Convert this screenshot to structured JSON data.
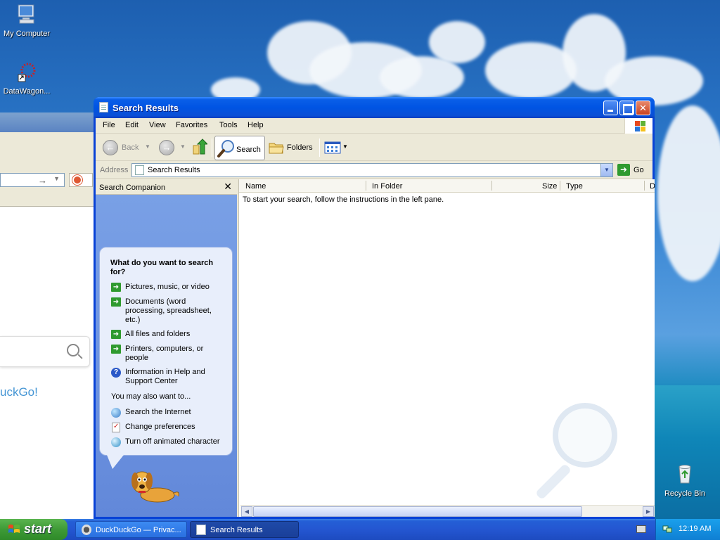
{
  "desktop": {
    "icons": [
      {
        "label": "My Computer"
      },
      {
        "label": "DataWagon..."
      },
      {
        "label": "Recycle Bin"
      }
    ]
  },
  "background_window": {
    "page_text": "uckGo!"
  },
  "window": {
    "title": "Search Results",
    "menu": [
      "File",
      "Edit",
      "View",
      "Favorites",
      "Tools",
      "Help"
    ],
    "toolbar": {
      "back_label": "Back",
      "search_label": "Search",
      "folders_label": "Folders"
    },
    "address": {
      "label": "Address",
      "value": "Search Results",
      "go_label": "Go"
    }
  },
  "companion": {
    "title": "Search Companion",
    "question": "What do you want to search for?",
    "options": [
      {
        "label": "Pictures, music, or video"
      },
      {
        "label": "Documents (word processing, spreadsheet, etc.)"
      },
      {
        "label": "All files and folders"
      },
      {
        "label": "Printers, computers, or people"
      },
      {
        "label": "Information in Help and Support Center"
      }
    ],
    "also_label": "You may also want to...",
    "also_options": [
      {
        "label": "Search the Internet"
      },
      {
        "label": "Change preferences"
      },
      {
        "label": "Turn off animated character"
      }
    ]
  },
  "results": {
    "columns": [
      "Name",
      "In Folder",
      "Size",
      "Type",
      "D"
    ],
    "message": "To start your search, follow the instructions in the left pane."
  },
  "taskbar": {
    "start_label": "start",
    "tasks": [
      {
        "label": "DuckDuckGo — Privac..."
      },
      {
        "label": "Search Results"
      }
    ],
    "clock": "12:19 AM"
  }
}
